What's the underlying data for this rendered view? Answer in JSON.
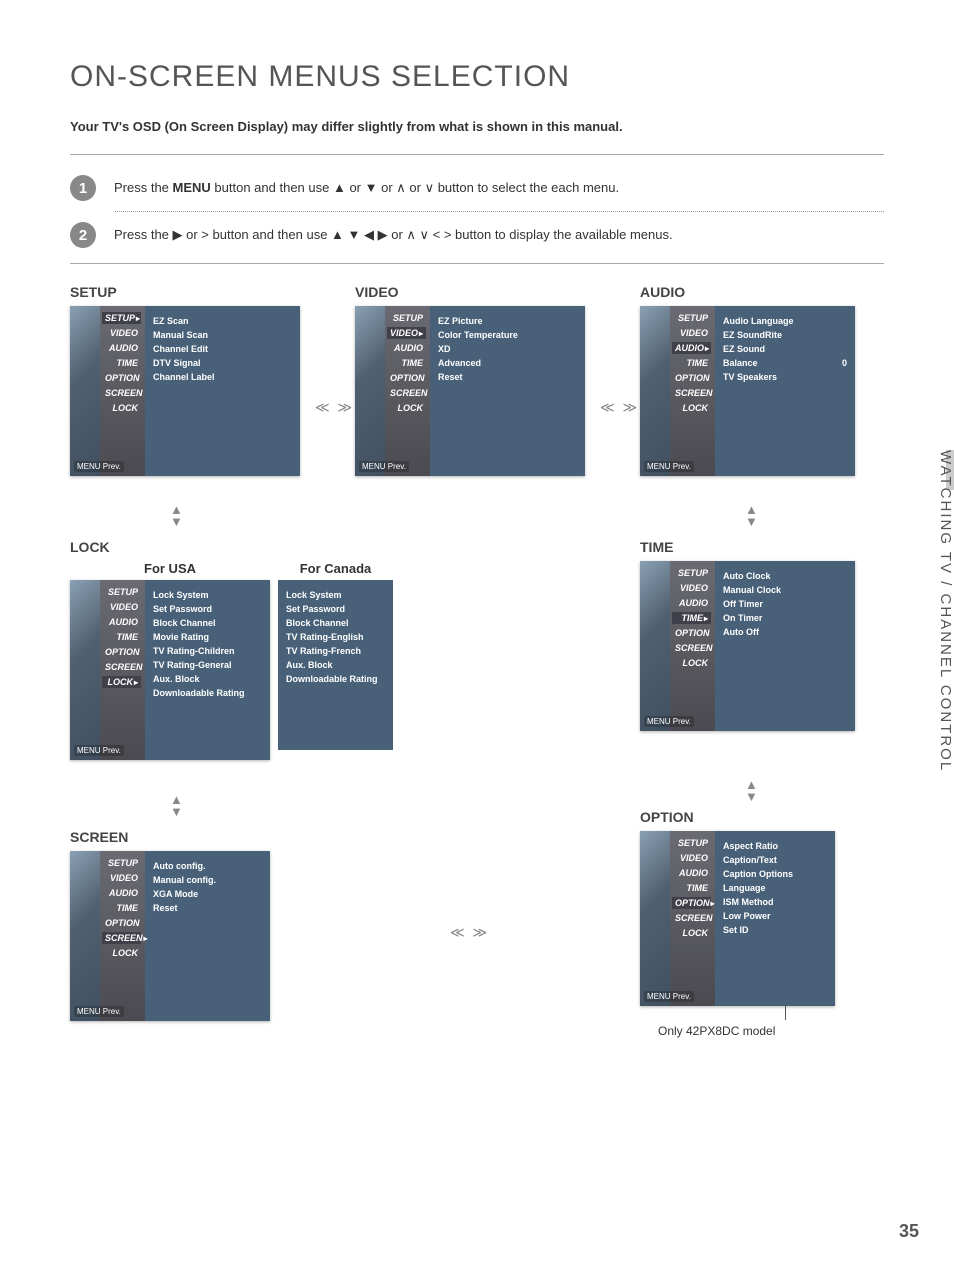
{
  "title": "ON-SCREEN MENUS SELECTION",
  "subtitle": "Your TV's OSD (On Screen Display) may differ slightly from what is shown in this manual.",
  "steps": {
    "s1_num": "1",
    "s1_a": "Press the ",
    "s1_menu": "MENU",
    "s1_b": " button and then use  ▲ or ▼  or  ∧  or  ∨  button to select the each menu.",
    "s2_num": "2",
    "s2_a": "Press the ▶  or  >  button and then use ▲ ▼ ◀ ▶ or  ∧ ∨  <  > button to display the available menus."
  },
  "side_label": "WATCHING TV / CHANNEL CONTROL",
  "page_number": "35",
  "prev_label": "MENU Prev.",
  "footer_note": "Only 42PX8DC model",
  "left_menu": [
    "SETUP",
    "VIDEO",
    "AUDIO",
    "TIME",
    "OPTION",
    "SCREEN",
    "LOCK"
  ],
  "arrows_h": "≪ ≫",
  "arrow_up": "▲",
  "arrow_down": "▼",
  "menus": {
    "setup": {
      "label": "SETUP",
      "sel": "SETUP",
      "options": [
        "EZ Scan",
        "Manual Scan",
        "Channel Edit",
        "DTV Signal",
        "Channel Label"
      ]
    },
    "video": {
      "label": "VIDEO",
      "sel": "VIDEO",
      "options": [
        "EZ Picture",
        "Color Temperature",
        "XD",
        "Advanced",
        "Reset"
      ]
    },
    "audio": {
      "label": "AUDIO",
      "sel": "AUDIO",
      "options": [
        "Audio Language",
        "EZ SoundRite",
        "EZ Sound",
        "Balance",
        "TV Speakers"
      ],
      "balance_value": "0"
    },
    "lock": {
      "label": "LOCK",
      "sel": "LOCK",
      "usa_label": "For USA",
      "canada_label": "For Canada",
      "options_usa": [
        "Lock System",
        "Set Password",
        "Block Channel",
        "Movie Rating",
        "TV Rating-Children",
        "TV Rating-General",
        "Aux. Block",
        "Downloadable Rating"
      ],
      "options_can": [
        "Lock System",
        "Set Password",
        "Block Channel",
        "TV Rating-English",
        "TV Rating-French",
        "Aux. Block",
        "Downloadable Rating"
      ]
    },
    "time": {
      "label": "TIME",
      "sel": "TIME",
      "options": [
        "Auto Clock",
        "Manual Clock",
        "Off Timer",
        "On Timer",
        "Auto Off"
      ]
    },
    "screen": {
      "label": "SCREEN",
      "sel": "SCREEN",
      "options": [
        "Auto config.",
        "Manual config.",
        "XGA Mode",
        "Reset"
      ]
    },
    "option": {
      "label": "OPTION",
      "sel": "OPTION",
      "options": [
        "Aspect Ratio",
        "Caption/Text",
        "Caption Options",
        "Language",
        "ISM Method",
        "Low Power",
        "Set ID"
      ]
    }
  }
}
